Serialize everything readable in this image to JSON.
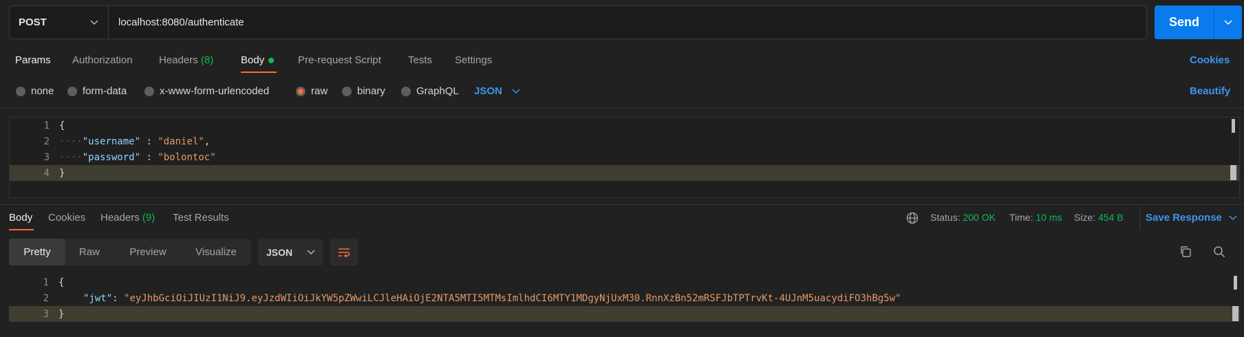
{
  "request": {
    "method": "POST",
    "url": "localhost:8080/authenticate",
    "send_label": "Send"
  },
  "request_tabs": {
    "params": "Params",
    "authorization": "Authorization",
    "headers": "Headers",
    "headers_count": "(8)",
    "body": "Body",
    "prerequest": "Pre-request Script",
    "tests": "Tests",
    "settings": "Settings",
    "cookies": "Cookies"
  },
  "body_types": {
    "none": "none",
    "form_data": "form-data",
    "urlencoded": "x-www-form-urlencoded",
    "raw": "raw",
    "binary": "binary",
    "graphql": "GraphQL",
    "format": "JSON",
    "beautify": "Beautify",
    "selected": "raw"
  },
  "request_body": {
    "line_numbers": [
      "1",
      "2",
      "3",
      "4"
    ],
    "open_brace": "{",
    "close_brace": "}",
    "username_key": "\"username\"",
    "username_value": "\"daniel\"",
    "password_key": "\"password\"",
    "password_value": "\"bolontoc\""
  },
  "response_tabs": {
    "body": "Body",
    "cookies": "Cookies",
    "headers": "Headers",
    "headers_count": "(9)",
    "test_results": "Test Results"
  },
  "response_status": {
    "status_label": "Status:",
    "status_value": "200 OK",
    "time_label": "Time:",
    "time_value": "10 ms",
    "size_label": "Size:",
    "size_value": "454 B",
    "save_response": "Save Response"
  },
  "view_modes": {
    "pretty": "Pretty",
    "raw": "Raw",
    "preview": "Preview",
    "visualize": "Visualize",
    "format": "JSON"
  },
  "response_body": {
    "line_numbers": [
      "1",
      "2",
      "3"
    ],
    "open_brace": "{",
    "close_brace": "}",
    "jwt_key": "\"jwt\"",
    "jwt_value": "\"eyJhbGciOiJIUzI1NiJ9.eyJzdWIiOiJkYW5pZWwiLCJleHAiOjE2NTA5MTI5MTMsImlhdCI6MTY1MDgyNjUxM30.RnnXzBn52mRSFJbTPTrvKt-4UJnM5uacydiFO3hBg5w\""
  },
  "colors": {
    "accent": "#ff6c37",
    "send": "#097bed",
    "link": "#3c96f0",
    "success": "#0cbb52"
  }
}
